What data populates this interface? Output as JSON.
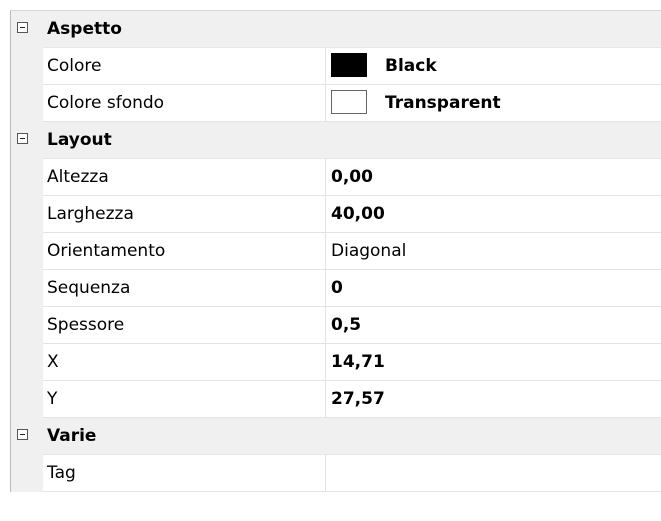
{
  "property_grid": {
    "categories": [
      {
        "label": "Aspetto",
        "properties": [
          {
            "name": "Colore",
            "value": "Black",
            "swatch_color": "#000000"
          },
          {
            "name": "Colore sfondo",
            "value": "Transparent",
            "swatch_color": "#ffffff"
          }
        ]
      },
      {
        "label": "Layout",
        "properties": [
          {
            "name": "Altezza",
            "value": "0,00"
          },
          {
            "name": "Larghezza",
            "value": "40,00"
          },
          {
            "name": "Orientamento",
            "value": "Diagonal"
          },
          {
            "name": "Sequenza",
            "value": "0"
          },
          {
            "name": "Spessore",
            "value": "0,5"
          },
          {
            "name": "X",
            "value": "14,71"
          },
          {
            "name": "Y",
            "value": "27,57"
          }
        ]
      },
      {
        "label": "Varie",
        "properties": [
          {
            "name": "Tag",
            "value": ""
          }
        ]
      }
    ]
  }
}
